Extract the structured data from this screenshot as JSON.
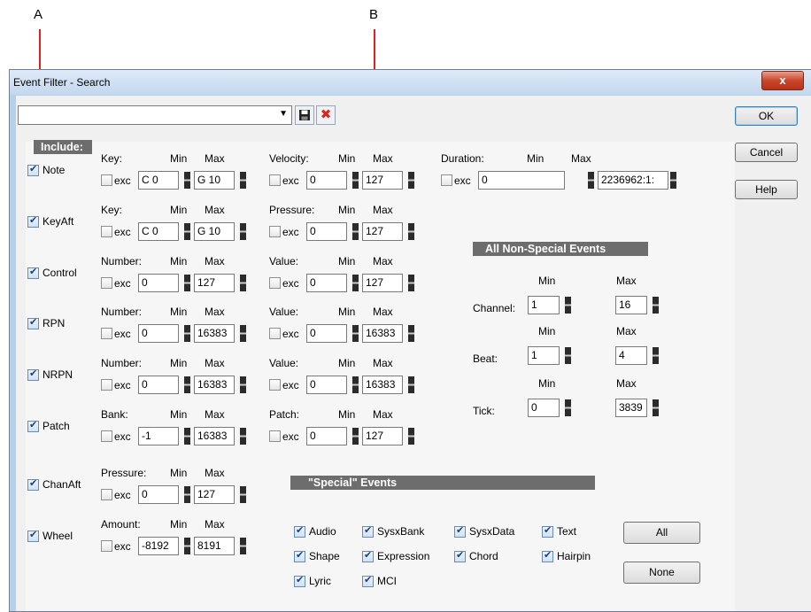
{
  "callouts": {
    "a": "A",
    "b": "B"
  },
  "window": {
    "title": "Event Filter - Search",
    "close_glyph": "x"
  },
  "toolbar": {
    "search_value": "",
    "dropdown_icon": "▼",
    "save_icon": "floppy-disk",
    "delete_icon": "✖"
  },
  "buttons": {
    "ok": "OK",
    "cancel": "Cancel",
    "help": "Help",
    "all": "All",
    "none": "None"
  },
  "headers": {
    "include": "Include:",
    "non_special": "All Non-Special Events",
    "special": "\"Special\" Events"
  },
  "common": {
    "min": "Min",
    "max": "Max",
    "exc": "exc"
  },
  "rows": {
    "note": {
      "label": "Note",
      "checked": true,
      "fields": [
        {
          "name": "Key:",
          "exc": false,
          "min": "C 0",
          "max": "G 10"
        },
        {
          "name": "Velocity:",
          "exc": false,
          "min": "0",
          "max": "127"
        },
        {
          "name": "Duration:",
          "exc": false,
          "min": "0",
          "max": "2236962:1:"
        }
      ]
    },
    "keyaft": {
      "label": "KeyAft",
      "checked": true,
      "fields": [
        {
          "name": "Key:",
          "exc": false,
          "min": "C 0",
          "max": "G 10"
        },
        {
          "name": "Pressure:",
          "exc": false,
          "min": "0",
          "max": "127"
        }
      ]
    },
    "control": {
      "label": "Control",
      "checked": true,
      "fields": [
        {
          "name": "Number:",
          "exc": false,
          "min": "0",
          "max": "127"
        },
        {
          "name": "Value:",
          "exc": false,
          "min": "0",
          "max": "127"
        }
      ]
    },
    "rpn": {
      "label": "RPN",
      "checked": true,
      "fields": [
        {
          "name": "Number:",
          "exc": false,
          "min": "0",
          "max": "16383"
        },
        {
          "name": "Value:",
          "exc": false,
          "min": "0",
          "max": "16383"
        }
      ]
    },
    "nrpn": {
      "label": "NRPN",
      "checked": true,
      "fields": [
        {
          "name": "Number:",
          "exc": false,
          "min": "0",
          "max": "16383"
        },
        {
          "name": "Value:",
          "exc": false,
          "min": "0",
          "max": "16383"
        }
      ]
    },
    "patch": {
      "label": "Patch",
      "checked": true,
      "fields": [
        {
          "name": "Bank:",
          "exc": false,
          "min": "-1",
          "max": "16383"
        },
        {
          "name": "Patch:",
          "exc": false,
          "min": "0",
          "max": "127"
        }
      ]
    },
    "chanaft": {
      "label": "ChanAft",
      "checked": true,
      "fields": [
        {
          "name": "Pressure:",
          "exc": false,
          "min": "0",
          "max": "127"
        }
      ]
    },
    "wheel": {
      "label": "Wheel",
      "checked": true,
      "fields": [
        {
          "name": "Amount:",
          "exc": false,
          "min": "-8192",
          "max": "8191"
        }
      ]
    }
  },
  "non_special": {
    "channel": {
      "label": "Channel:",
      "min": "1",
      "max": "16"
    },
    "beat": {
      "label": "Beat:",
      "min": "1",
      "max": "4"
    },
    "tick": {
      "label": "Tick:",
      "min": "0",
      "max": "3839"
    }
  },
  "special": {
    "audio": {
      "label": "Audio",
      "checked": true
    },
    "sysxbank": {
      "label": "SysxBank",
      "checked": true
    },
    "sysxdata": {
      "label": "SysxData",
      "checked": true
    },
    "text": {
      "label": "Text",
      "checked": true
    },
    "shape": {
      "label": "Shape",
      "checked": true
    },
    "expression": {
      "label": "Expression",
      "checked": true
    },
    "chord": {
      "label": "Chord",
      "checked": true
    },
    "hairpin": {
      "label": "Hairpin",
      "checked": true
    },
    "lyric": {
      "label": "Lyric",
      "checked": true
    },
    "mci": {
      "label": "MCI",
      "checked": true
    }
  },
  "colors": {
    "callout_line": "#e0201a",
    "header_bg": "#6d6d6d",
    "window_frame": "#b8d1ea",
    "close_button": "#c9462b"
  }
}
